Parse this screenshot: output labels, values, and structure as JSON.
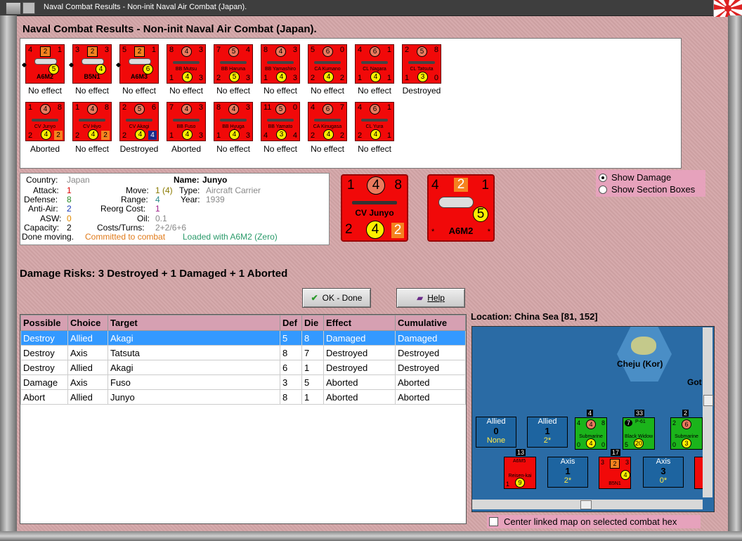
{
  "window": {
    "title": "Naval Combat Results - Non-init Naval Air Combat (Japan)."
  },
  "heading": "Naval Combat Results - Non-init Naval Air Combat (Japan).",
  "units_row1": [
    {
      "name": "A6M2",
      "tl": "4",
      "top": "2",
      "tr": "1",
      "bl": "",
      "bot": "5",
      "br": "",
      "kind": "plane",
      "result": "No effect"
    },
    {
      "name": "B5N1",
      "tl": "3",
      "top": "2",
      "tr": "3",
      "bl": "",
      "bot": "4",
      "br": "",
      "kind": "plane",
      "result": "No effect"
    },
    {
      "name": "A6M3",
      "tl": "5",
      "top": "2",
      "tr": "1",
      "bl": "",
      "bot": "6",
      "br": "",
      "kind": "plane",
      "result": "No effect"
    },
    {
      "name": "BB Mutsu",
      "tl": "8",
      "top": "4",
      "tr": "3",
      "bl": "1",
      "bot": "4",
      "br": "3",
      "kind": "ship",
      "result": "No effect"
    },
    {
      "name": "BB Haruna",
      "tl": "7",
      "top": "5",
      "tr": "4",
      "bl": "2",
      "bot": "5",
      "br": "3",
      "kind": "ship",
      "result": "No effect"
    },
    {
      "name": "BB Yamashiro",
      "tl": "8",
      "top": "4",
      "tr": "3",
      "bl": "1",
      "bot": "4",
      "br": "3",
      "kind": "ship",
      "result": "No effect"
    },
    {
      "name": "CA Kumano",
      "tl": "5",
      "top": "6",
      "tr": "0",
      "bl": "2",
      "bot": "4",
      "br": "2",
      "kind": "ship",
      "result": "No effect"
    },
    {
      "name": "CL Nagara",
      "tl": "4",
      "top": "6",
      "tr": "1",
      "bl": "1",
      "bot": "4",
      "br": "1",
      "kind": "ship",
      "result": "No effect"
    },
    {
      "name": "CL Tatsuta",
      "tl": "2",
      "top": "5",
      "tr": "8",
      "bl": "1",
      "bot": "3",
      "br": "0",
      "kind": "ship",
      "result": "Destroyed"
    }
  ],
  "units_row2": [
    {
      "name": "CV Junyo",
      "tl": "1",
      "top": "4",
      "tr": "8",
      "bl": "2",
      "bot": "4",
      "br": "2",
      "kind": "ship",
      "extra": "orange",
      "result": "Aborted"
    },
    {
      "name": "CV Hiyo",
      "tl": "1",
      "top": "4",
      "tr": "8",
      "bl": "2",
      "bot": "4",
      "br": "2",
      "kind": "ship",
      "extra": "orange",
      "result": "No effect"
    },
    {
      "name": "CV Akagi",
      "tl": "2",
      "top": "5",
      "tr": "6",
      "bl": "2",
      "bot": "4",
      "br": "4",
      "kind": "ship",
      "extra": "blue",
      "result": "Destroyed"
    },
    {
      "name": "BB Fuso",
      "tl": "7",
      "top": "4",
      "tr": "3",
      "bl": "1",
      "bot": "4",
      "br": "3",
      "kind": "ship",
      "result": "Aborted"
    },
    {
      "name": "BB Hyuga",
      "tl": "8",
      "top": "4",
      "tr": "3",
      "bl": "1",
      "bot": "4",
      "br": "3",
      "kind": "ship",
      "result": "No effect"
    },
    {
      "name": "BB Yamato",
      "tl": "11",
      "top": "5",
      "tr": "0",
      "bl": "4",
      "bot": "3",
      "br": "4",
      "kind": "ship",
      "result": "No effect"
    },
    {
      "name": "CA Kinugasa",
      "tl": "4",
      "top": "6",
      "tr": "7",
      "bl": "2",
      "bot": "4",
      "br": "2",
      "kind": "ship",
      "result": "No effect"
    },
    {
      "name": "CL Yura",
      "tl": "4",
      "top": "6",
      "tr": "1",
      "bl": "2",
      "bot": "4",
      "br": "1",
      "kind": "ship",
      "result": "No effect"
    }
  ],
  "info": {
    "country_label": "Country:",
    "country": "Japan",
    "attack_label": "Attack:",
    "attack": "1",
    "defense_label": "Defense:",
    "defense": "8",
    "antiair_label": "Anti-Air:",
    "antiair": "2",
    "asw_label": "ASW:",
    "asw": "0",
    "capacity_label": "Capacity:",
    "capacity": "2",
    "name_label": "Name:",
    "name": "Junyo",
    "move_label": "Move:",
    "move": "1 (4)",
    "type_label": "Type:",
    "type": "Aircraft Carrier",
    "range_label": "Range:",
    "range": "4",
    "year_label": "Year:",
    "year": "1939",
    "reorg_label": "Reorg Cost:",
    "reorg": "1",
    "oil_label": "Oil:",
    "oil": "0.1",
    "costs_label": "Costs/Turns:",
    "costs": "2+2/6+6",
    "status1": "Done moving.",
    "status2": "Committed to combat",
    "status3": "Loaded with A6M2 (Zero)"
  },
  "big_ship": {
    "tl": "1",
    "top": "4",
    "tr": "8",
    "name": "CV Junyo",
    "bl": "2",
    "bot": "4",
    "br": "2"
  },
  "big_plane": {
    "tl": "4",
    "top": "2",
    "tr": "1",
    "name": "A6M2",
    "bot": "5",
    "bl": "*",
    "br": "*"
  },
  "options": {
    "show_damage": "Show Damage",
    "show_sections": "Show Section Boxes"
  },
  "risks": "Damage Risks: 3 Destroyed + 1 Damaged + 1 Aborted",
  "buttons": {
    "ok": "OK - Done",
    "help": "Help"
  },
  "table": {
    "headers": [
      "Possible",
      "Choice",
      "Target",
      "Def",
      "Die",
      "Effect",
      "Cumulative"
    ],
    "rows": [
      [
        "Destroy",
        "Allied",
        "Akagi",
        "5",
        "8",
        "Damaged",
        "Damaged"
      ],
      [
        "Destroy",
        "Axis",
        "Tatsuta",
        "8",
        "7",
        "Destroyed",
        "Destroyed"
      ],
      [
        "Destroy",
        "Allied",
        "Akagi",
        "6",
        "1",
        "Destroyed",
        "Destroyed"
      ],
      [
        "Damage",
        "Axis",
        "Fuso",
        "3",
        "5",
        "Aborted",
        "Aborted"
      ],
      [
        "Abort",
        "Allied",
        "Junyo",
        "8",
        "1",
        "Aborted",
        "Aborted"
      ]
    ]
  },
  "location": {
    "label": "Location:",
    "value": "China Sea [81, 152]"
  },
  "map": {
    "hex_name": "Cheju (Kor)",
    "edge_text": "Got",
    "allied_box1": {
      "title": "Allied",
      "v": "0",
      "s": "None"
    },
    "allied_box2": {
      "title": "Allied",
      "v": "1",
      "s": "2*"
    },
    "axis_box1": {
      "title": "Axis",
      "v": "1",
      "s": "2*"
    },
    "axis_box2": {
      "title": "Axis",
      "v": "3",
      "s": "0*"
    },
    "sub1": {
      "tag": "4",
      "name": "Submarine",
      "tl": "4",
      "top": "4",
      "tr": "8",
      "bl": "0",
      "bot": "4",
      "br": "0"
    },
    "p61": {
      "tag": "33",
      "name": "Black Widow",
      "tl": "7",
      "top": "P-61",
      "tr": "",
      "bl": "5",
      "bot": "20",
      "br": ""
    },
    "sub2": {
      "tag": "2",
      "name": "Submarine",
      "tl": "2",
      "top": "6",
      "tr": "",
      "bl": "0",
      "bot": "3",
      "br": ""
    },
    "a6m5": {
      "tag": "13",
      "name": "Reisen-kai",
      "top": "A6M5",
      "bl": "1",
      "bot": "9"
    },
    "b5n1": {
      "tag": "17",
      "name": "B5N1",
      "tl": "3",
      "top": "2",
      "tr": "3",
      "bot": "4"
    }
  },
  "center_check": "Center linked map on selected combat hex"
}
